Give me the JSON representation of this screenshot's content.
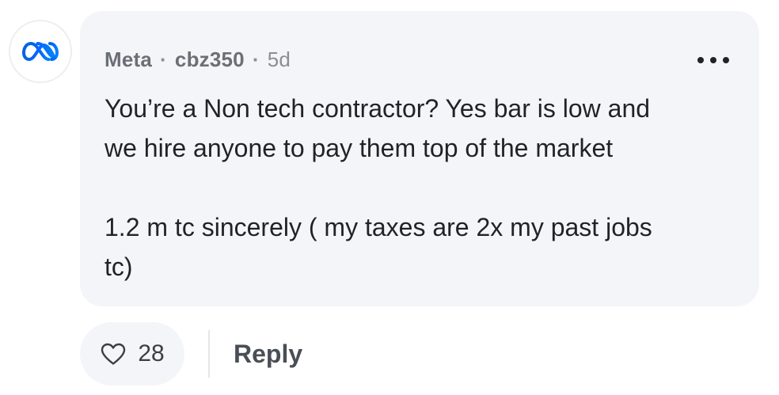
{
  "comment": {
    "company": "Meta",
    "separator": "·",
    "username": "cbz350",
    "timestamp": "5d",
    "body_lines": [
      "You’re a Non tech contractor? Yes bar is low and",
      "we hire anyone to pay them top of the market",
      "1.2 m tc sincerely ( my taxes are 2x my past jobs",
      "tc)"
    ],
    "avatar_icon": "meta-logo-icon",
    "more_icon": "more-options-icon"
  },
  "actions": {
    "like_icon": "heart-icon",
    "like_count": "28",
    "reply_label": "Reply"
  },
  "colors": {
    "bubble_bg": "#f4f5f8",
    "text": "#1f2329",
    "muted": "#6b6f76",
    "meta_blue": "#0866ff"
  }
}
